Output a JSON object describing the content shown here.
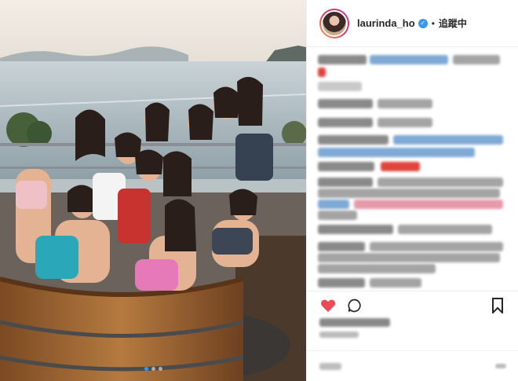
{
  "post": {
    "username": "laurinda_ho",
    "verified_icon": "verified-badge-icon",
    "separator": "•",
    "follow_label": "追蹤中",
    "photo_description_icon": "group-photo-hot-tub",
    "carousel": {
      "count": 3,
      "active_index": 1
    }
  },
  "actions": {
    "like_icon": "heart-filled-icon",
    "like_color": "#ed4956",
    "comment_icon": "speech-bubble-icon",
    "bookmark_icon": "bookmark-icon"
  },
  "colors": {
    "accent": "#3897f0",
    "text": "#262626",
    "border": "#efefef"
  }
}
